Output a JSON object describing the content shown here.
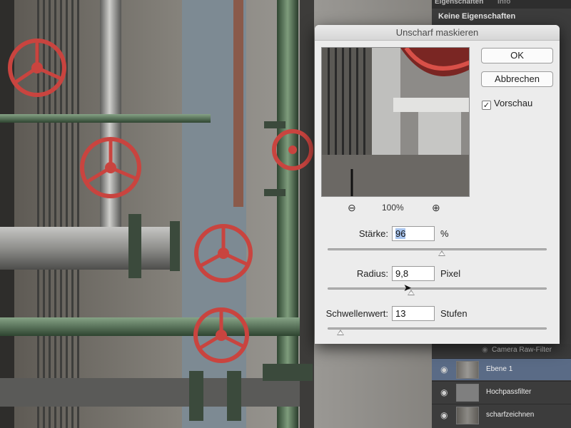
{
  "right_panel": {
    "tabs": [
      "Eigenschaften",
      "Info"
    ],
    "properties_text": "Keine Eigenschaften",
    "camera_raw_filter": "Camera Raw-Filter",
    "layers": [
      {
        "name": "Ebene 1",
        "active": true
      },
      {
        "name": "Hochpassfilter",
        "active": false
      },
      {
        "name": "scharfzeichnen",
        "active": false
      }
    ]
  },
  "dialog": {
    "title": "Unscharf maskieren",
    "ok_label": "OK",
    "cancel_label": "Abbrechen",
    "preview_label": "Vorschau",
    "preview_checked": true,
    "zoom": "100%",
    "params": {
      "amount": {
        "label": "Stärke:",
        "value": "96",
        "unit": "%",
        "slider_fraction": 0.52
      },
      "radius": {
        "label": "Radius:",
        "value": "9,8",
        "unit": "Pixel",
        "slider_fraction": 0.38
      },
      "threshold": {
        "label": "Schwellenwert:",
        "value": "13",
        "unit": "Stufen",
        "slider_fraction": 0.06
      }
    }
  },
  "colors": {
    "dialog_bg": "#ececec",
    "panel_bg": "#3c3c3c",
    "active_layer": "#5a6b86",
    "valve_red": "#c8423e",
    "pipe_green": "#4e6e4e"
  },
  "icons": [
    "zoom-out-icon",
    "zoom-in-icon",
    "eye-icon",
    "checkbox-checked-icon",
    "cursor-arrow-icon"
  ]
}
